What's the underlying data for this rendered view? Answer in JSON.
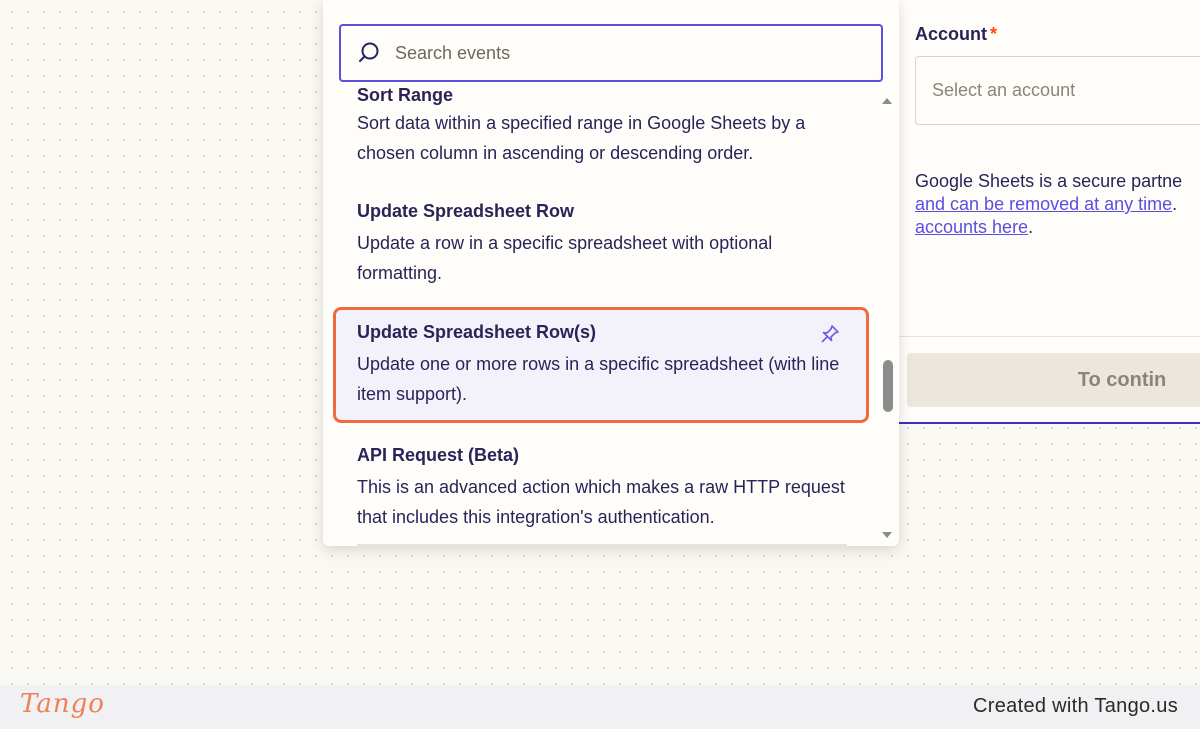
{
  "side_panel": {
    "account_label": "Account",
    "required_mark": "*",
    "account_placeholder": "Select an account",
    "partner_line1": "Google Sheets is a secure partne",
    "partner_link1": "and can be removed at any time",
    "partner_link1_suffix": ".",
    "partner_link2": "accounts here",
    "partner_link2_suffix": ".",
    "continue_label": "To contin"
  },
  "dropdown": {
    "search_placeholder": "Search events",
    "items": [
      {
        "title": "Sort Range",
        "description": "Sort data within a specified range in Google Sheets by a chosen column in ascending or descending order."
      },
      {
        "title": "Update Spreadsheet Row",
        "description": "Update a row in a specific spreadsheet with optional formatting."
      },
      {
        "title": "Update Spreadsheet Row(s)",
        "description": "Update one or more rows in a specific spreadsheet (with line item support).",
        "selected": true,
        "icon": "pin-icon"
      },
      {
        "title": "API Request (Beta)",
        "description": "This is an advanced action which makes a raw HTTP request that includes this integration's authentication."
      }
    ]
  },
  "footer": {
    "logo_text": "Tango",
    "created_text": "Created with Tango.us"
  },
  "colors": {
    "accent": "#5a4fe0",
    "highlight_border": "#ee6b42",
    "text": "#2b2358",
    "required": "#ff4a00"
  }
}
